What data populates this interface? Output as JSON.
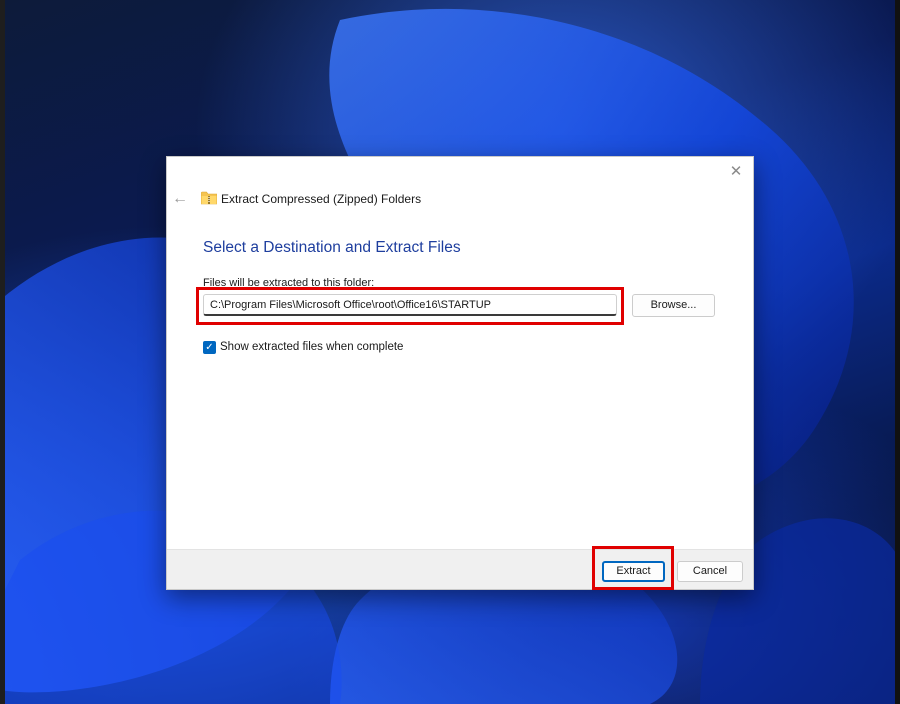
{
  "dialog": {
    "title": "Extract Compressed (Zipped) Folders",
    "heading": "Select a Destination and Extract Files",
    "destination_label": "Files will be extracted to this folder:",
    "destination_value": "C:\\Program Files\\Microsoft Office\\root\\Office16\\STARTUP",
    "browse_label": "Browse...",
    "show_files_label": "Show extracted files when complete",
    "show_files_checked": true,
    "extract_label": "Extract",
    "cancel_label": "Cancel"
  },
  "icons": {
    "close": "close-icon",
    "back": "back-arrow-icon",
    "folder": "zip-folder-icon",
    "check": "checkmark-icon"
  },
  "colors": {
    "accent": "#0067c0",
    "heading": "#1e3e9e",
    "highlight": "#e00000",
    "footer": "#f0f0f0"
  }
}
